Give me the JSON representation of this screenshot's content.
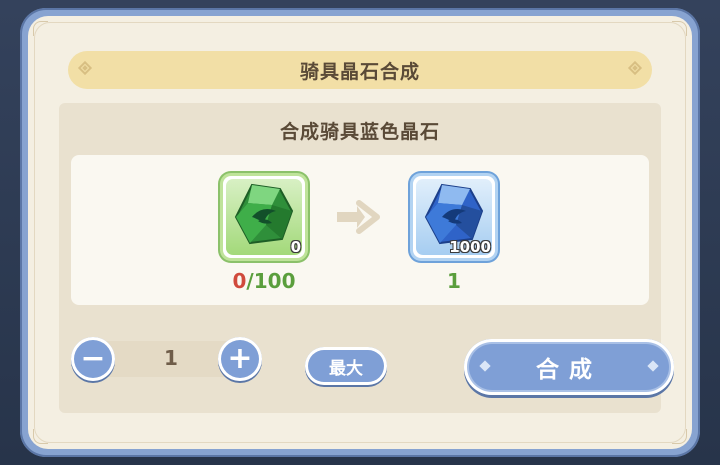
{
  "dialog": {
    "title": "骑具晶石合成",
    "section_title": "合成骑具蓝色晶石"
  },
  "recipe": {
    "input": {
      "icon": "green-crystal-icon",
      "count_badge": "0",
      "have": "0",
      "separator": "/",
      "need": "100"
    },
    "output": {
      "icon": "blue-crystal-icon",
      "count_badge": "1000",
      "yield": "1"
    }
  },
  "controls": {
    "minus_label": "−",
    "quantity": "1",
    "plus_label": "+",
    "max_label": "最大",
    "synthesize_label": "合成"
  },
  "colors": {
    "frame": "#87a3d1",
    "panel": "#f4efe2",
    "title_bar": "#f2dfa6",
    "button": "#7f9fd6",
    "insufficient": "#d04a3c",
    "sufficient": "#5a9e3c"
  }
}
